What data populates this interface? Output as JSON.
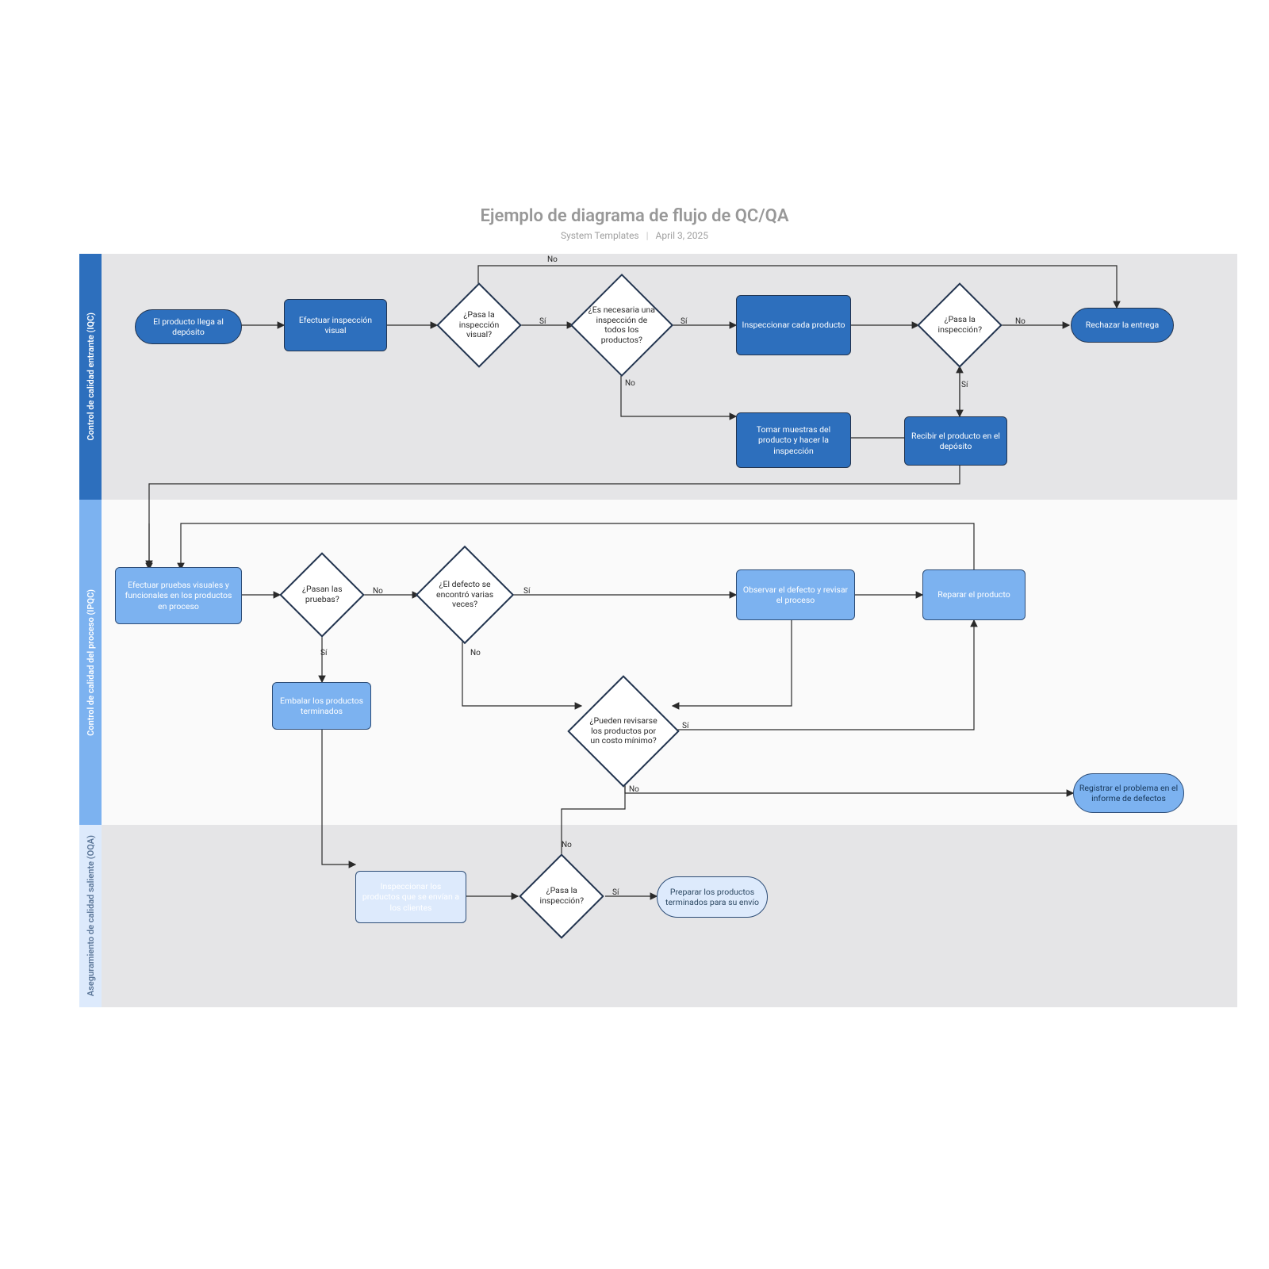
{
  "title": "Ejemplo de diagrama de flujo de QC/QA",
  "author": "System Templates",
  "date": "April 3, 2025",
  "lanes": {
    "iqc": "Control de calidad entrante (IQC)",
    "ipqc": "Control de calidad del proceso (IPQC)",
    "oqa": "Aseguramiento de calidad saliente (OQA)"
  },
  "nodes": {
    "n1": "El producto llega al depósito",
    "n2": "Efectuar inspección visual",
    "n3": "¿Pasa la inspección visual?",
    "n4": "¿Es necesaria una inspección de todos los productos?",
    "n5": "Inspeccionar cada producto",
    "n6": "¿Pasa la inspección?",
    "n7": "Rechazar la entrega",
    "n8": "Tomar muestras del producto y hacer la inspección",
    "n9": "Recibir el producto en el depósito",
    "n10": "Efectuar pruebas visuales y funcionales en los productos en proceso",
    "n11": "¿Pasan las pruebas?",
    "n12": "¿El defecto se encontró varias veces?",
    "n13": "Observar el defecto y revisar el proceso",
    "n14": "Reparar el producto",
    "n15": "Embalar los productos terminados",
    "n16": "¿Pueden revisarse los productos por un costo mínimo?",
    "n17": "Registrar el problema en el informe de defectos",
    "n18": "Inspeccionar los productos que se envían a los clientes",
    "n19": "¿Pasa la inspección?",
    "n20": "Preparar los productos terminados para su envío"
  },
  "labels": {
    "yes": "Sí",
    "no": "No"
  }
}
